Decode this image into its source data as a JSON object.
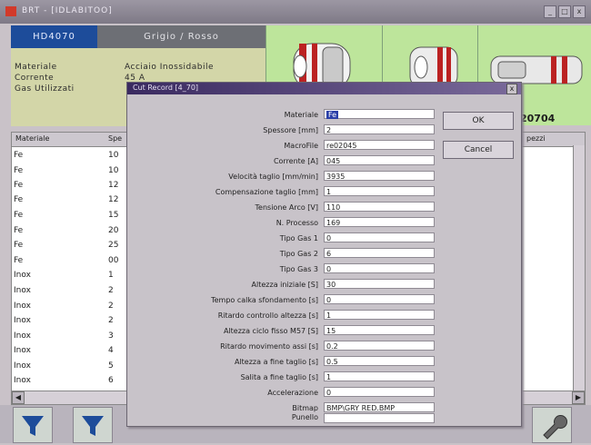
{
  "window": {
    "title": "BRT - [IDLABITOO]",
    "controls": [
      "_",
      "□",
      "x"
    ]
  },
  "header": {
    "code": "HD4070",
    "material_desc": "Grigio / Rosso"
  },
  "info": {
    "labels": [
      "Materiale",
      "Corrente",
      "Gas Utilizzati"
    ],
    "values": [
      "Acciaio Inossidabile",
      "45 A"
    ]
  },
  "part_code": "20704",
  "table": {
    "columns": [
      "Materiale",
      "Spe",
      "pezzi"
    ],
    "rows": [
      [
        "Fe",
        "10"
      ],
      [
        "Fe",
        "10"
      ],
      [
        "Fe",
        "12"
      ],
      [
        "Fe",
        "12"
      ],
      [
        "Fe",
        "15"
      ],
      [
        "Fe",
        "20"
      ],
      [
        "Fe",
        "25"
      ],
      [
        "Fe",
        "00"
      ],
      [
        "Inox",
        "1"
      ],
      [
        "Inox",
        "2"
      ],
      [
        "Inox",
        "2"
      ],
      [
        "Inox",
        "2"
      ],
      [
        "Inox",
        "3"
      ],
      [
        "Inox",
        "4"
      ],
      [
        "Inox",
        "5"
      ],
      [
        "Inox",
        "6"
      ]
    ]
  },
  "dialog": {
    "title": "Cut Record [4_70]",
    "ok_label": "OK",
    "cancel_label": "Cancel",
    "fields": [
      {
        "label": "Materiale",
        "value": "Fe"
      },
      {
        "label": "Spessore [mm]",
        "value": "2"
      },
      {
        "label": "MacroFile",
        "value": "re02045"
      },
      {
        "label": "Corrente [A]",
        "value": "045"
      },
      {
        "label": "Velocità taglio [mm/min]",
        "value": "3935"
      },
      {
        "label": "Compensazione taglio [mm]",
        "value": "1"
      },
      {
        "label": "Tensione Arco [V]",
        "value": "110"
      },
      {
        "label": "N. Processo",
        "value": "169"
      },
      {
        "label": "Tipo Gas 1",
        "value": "0"
      },
      {
        "label": "Tipo Gas 2",
        "value": "6"
      },
      {
        "label": "Tipo Gas 3",
        "value": "0"
      },
      {
        "label": "Altezza iniziale [S]",
        "value": "30"
      },
      {
        "label": "Tempo calka sfondamento [s]",
        "value": "0"
      },
      {
        "label": "Ritardo controllo altezza [s]",
        "value": "1"
      },
      {
        "label": "Altezza ciclo fisso M57 [S]",
        "value": "15"
      },
      {
        "label": "Ritardo movimento assi [s]",
        "value": "0.2"
      },
      {
        "label": "Altezza a fine taglio [s]",
        "value": "0.5"
      },
      {
        "label": "Salita a fine taglio [s]",
        "value": "1"
      },
      {
        "label": "Accelerazione",
        "value": "0"
      },
      {
        "label": "Bitmap",
        "value": "BMP\\GRY RED.BMP"
      },
      {
        "label": "Punello",
        "value": ""
      }
    ]
  },
  "colors": {
    "header_blue": "#1d4c9a",
    "info_bg": "#d3d6a8",
    "part_bg": "#bde59b"
  }
}
